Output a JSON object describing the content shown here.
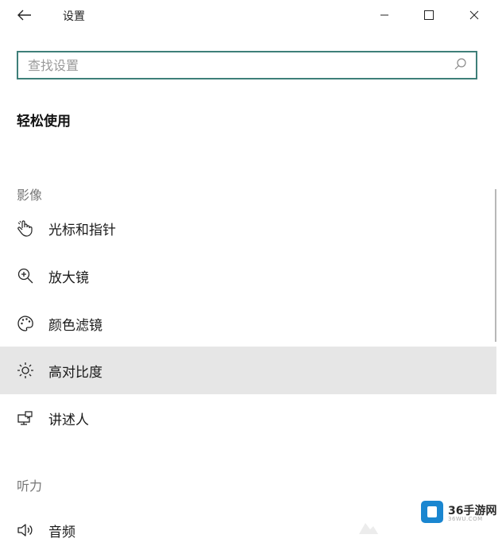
{
  "window": {
    "title": "设置",
    "back_icon": "arrow-left",
    "controls": [
      "minimize-icon",
      "maximize-icon",
      "close-icon"
    ]
  },
  "search": {
    "placeholder": "查找设置",
    "value": "",
    "icon": "search-icon",
    "border_color": "#3e7f79"
  },
  "page": {
    "title": "轻松使用"
  },
  "sections": [
    {
      "header": "影像",
      "items": [
        {
          "label": "光标和指针",
          "icon": "pointer-hand-icon",
          "selected": false
        },
        {
          "label": "放大镜",
          "icon": "magnifier-plus-icon",
          "selected": false
        },
        {
          "label": "颜色滤镜",
          "icon": "palette-icon",
          "selected": false
        },
        {
          "label": "高对比度",
          "icon": "brightness-icon",
          "selected": true
        },
        {
          "label": "讲述人",
          "icon": "narrator-icon",
          "selected": false
        }
      ]
    },
    {
      "header": "听力",
      "items": [
        {
          "label": "音频",
          "icon": "speaker-icon",
          "selected": false
        }
      ]
    }
  ],
  "watermark": {
    "text": "36手游网",
    "sub": "36WU.COM"
  },
  "colors": {
    "selected_bg": "#e6e6e6",
    "section_header": "#777777",
    "accent": "#3e7f79"
  }
}
